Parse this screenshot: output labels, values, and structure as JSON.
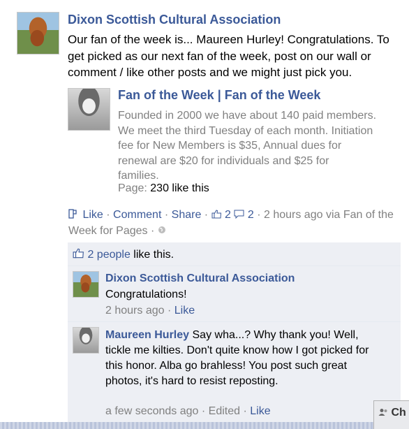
{
  "post": {
    "author": "Dixon Scottish Cultural Association",
    "message": "Our fan of the week is... Maureen Hurley! Congratulations. To get picked as our next fan of the week, post on our wall or comment / like other posts and we might just pick you."
  },
  "attachment": {
    "title": "Fan of the Week | Fan of the Week",
    "description": "Founded in 2000 we have about 140 paid members.\nWe meet the third Tuesday of each month. Initiation\nfee for New Members is $35, Annual dues for\nrenewal are $20 for individuals and $25 for\nfamilies.",
    "page_label": "Page:",
    "page_likes": "230 like this"
  },
  "actions": {
    "like": "Like",
    "comment": "Comment",
    "share": "Share",
    "like_count": "2",
    "comment_count": "2",
    "time": "2 hours ago via Fan of the Week for Pages",
    "dot": "·"
  },
  "likes_summary": {
    "people": "2 people",
    "suffix": " like this."
  },
  "comments": [
    {
      "name": "Dixon Scottish Cultural Association",
      "text": "Congratulations!",
      "time": "2 hours ago",
      "like": "Like"
    },
    {
      "name": "Maureen Hurley",
      "text": "Say wha...? Why thank you! Well, tickle me kilties. Don't quite know how I got picked for this honor. Alba go brahless! You post such great photos, it's hard to resist reposting.",
      "time": "a few seconds ago",
      "edited": "Edited",
      "like": "Like"
    }
  ],
  "chat": {
    "label": "Ch"
  },
  "colors": {
    "link": "#3b5998",
    "muted": "#808080",
    "ufi_bg": "#edeff4"
  },
  "icons": [
    "page-avatar",
    "attachment-thumbnail",
    "like-thumb-icon",
    "comment-bubble-icon",
    "globe-icon",
    "chat-person-icon"
  ]
}
